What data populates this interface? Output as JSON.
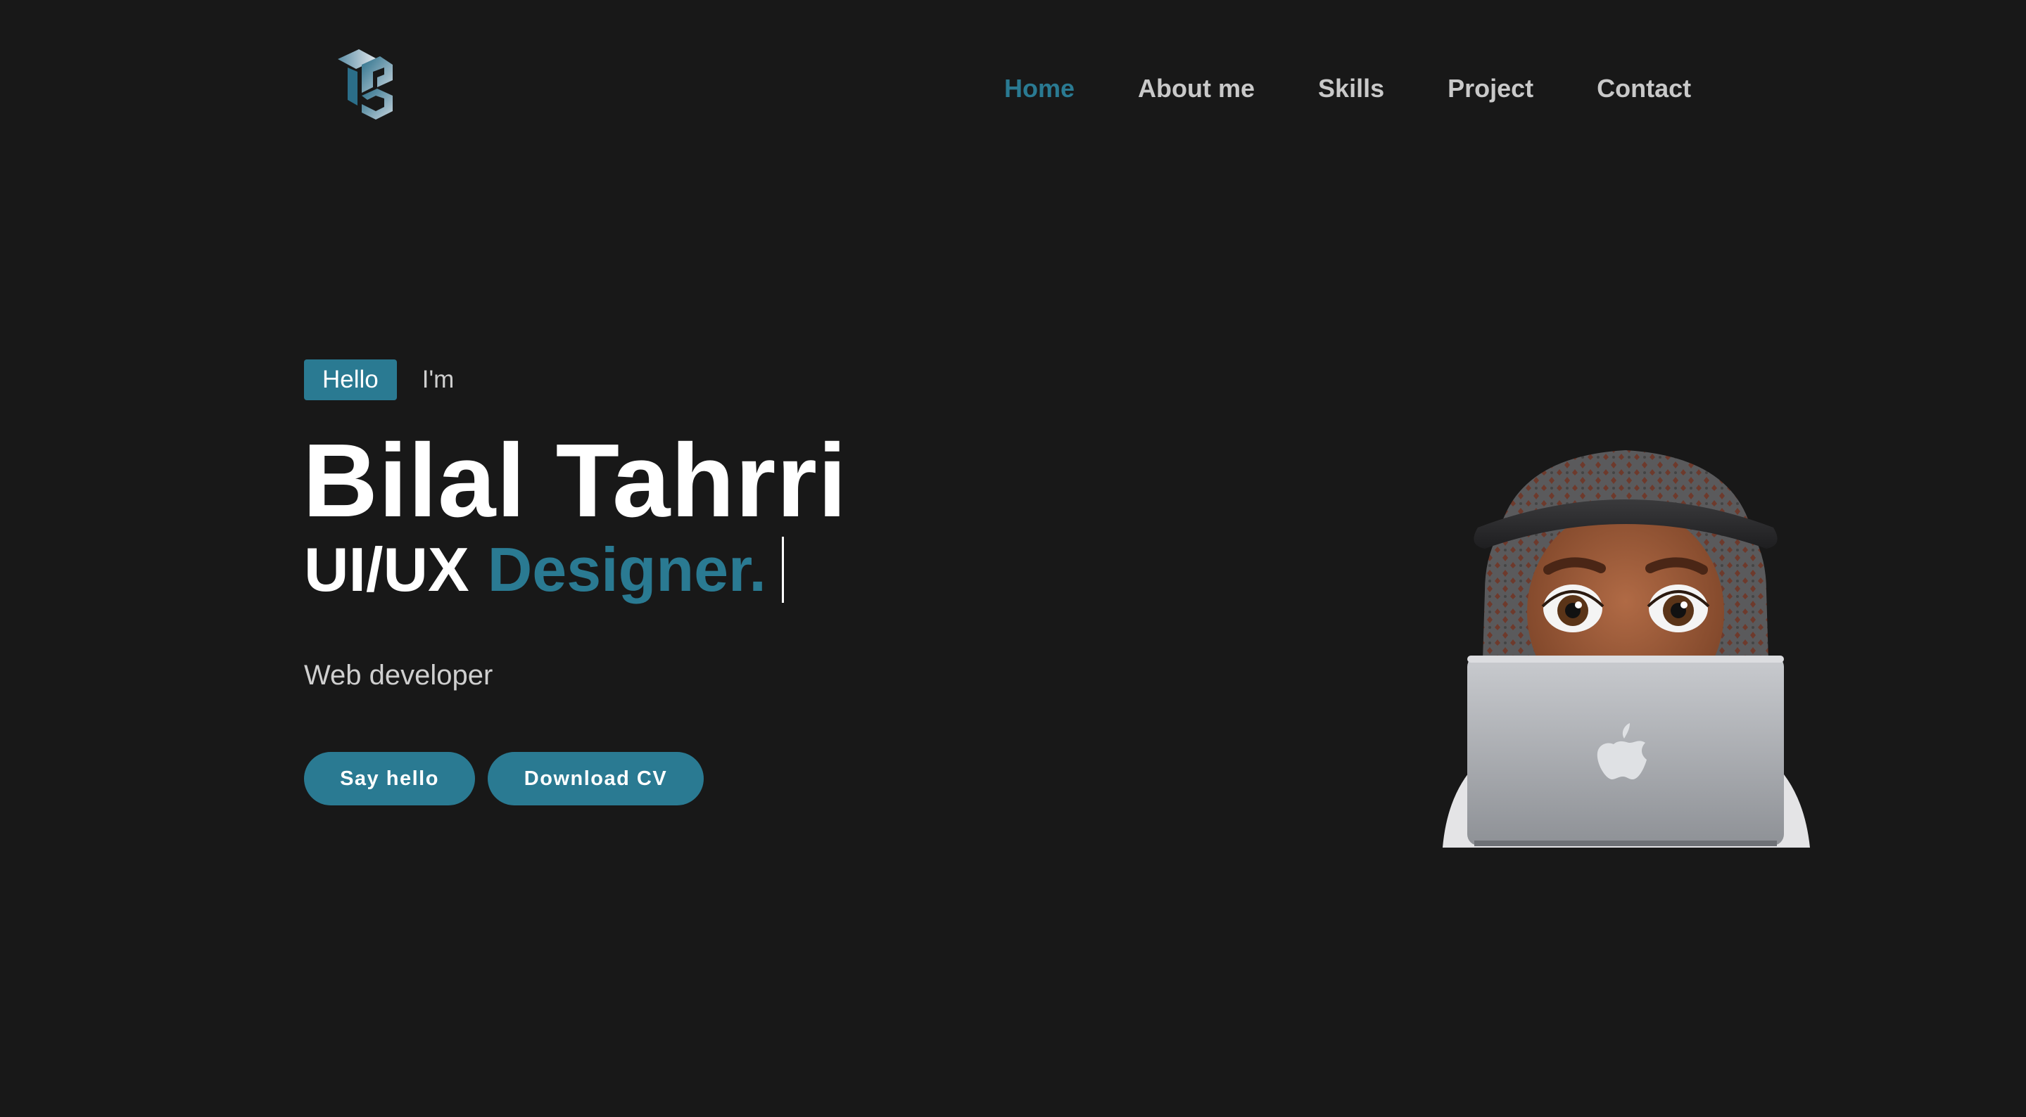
{
  "header": {
    "logo_icon": "tb-monogram-logo-icon",
    "nav": [
      {
        "label": "Home",
        "active": true
      },
      {
        "label": "About me",
        "active": false
      },
      {
        "label": "Skills",
        "active": false
      },
      {
        "label": "Project",
        "active": false
      },
      {
        "label": "Contact",
        "active": false
      }
    ]
  },
  "hero": {
    "badge": "Hello",
    "intro": "I'm",
    "name": "Bilal Tahrri",
    "role_part1": "UI/UX",
    "role_part2": "Designer.",
    "subtitle": "Web developer",
    "buttons": {
      "say_hello": "Say hello",
      "download_cv": "Download CV"
    },
    "avatar_icon": "memoji-avatar-with-laptop"
  },
  "colors": {
    "background": "#181818",
    "accent": "#2a7a92",
    "text": "#ffffff",
    "nav_text": "#c9c9c9"
  }
}
